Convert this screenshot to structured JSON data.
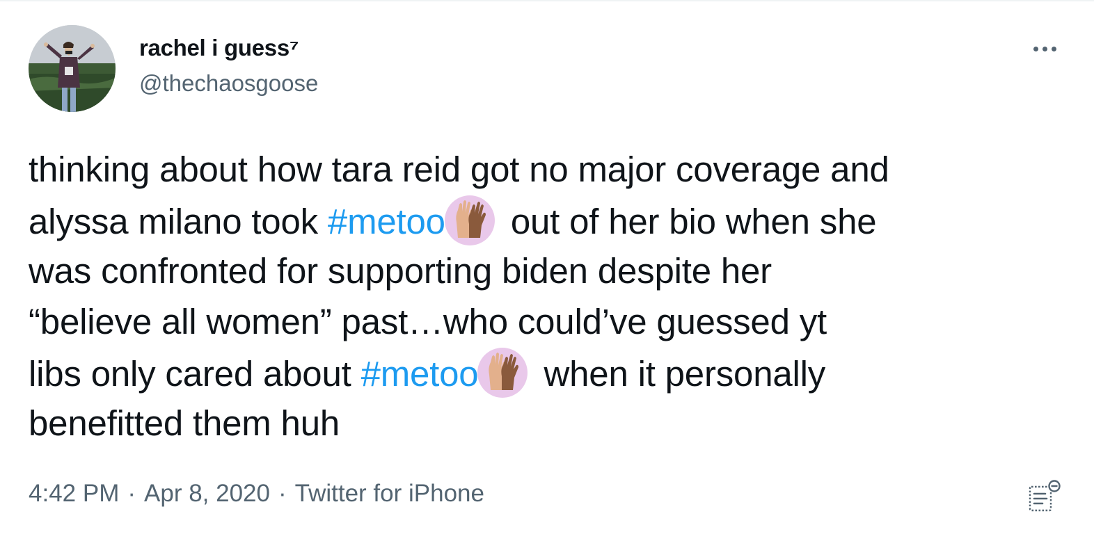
{
  "user": {
    "display_name": "rachel i guess⁷",
    "handle": "@thechaosgoose",
    "avatar_icon": "profile-photo"
  },
  "header": {
    "more_icon": "more-horizontal-icon"
  },
  "tweet": {
    "lines": [
      [
        {
          "t": "text",
          "v": "thinking about how tara reid got no major coverage and"
        }
      ],
      [
        {
          "t": "text",
          "v": "alyssa milano took "
        },
        {
          "t": "hashtag",
          "v": "#metoo"
        },
        {
          "t": "hashflag",
          "v": "raised-hands-hashflag"
        },
        {
          "t": "text",
          "v": "out of her bio when she"
        }
      ],
      [
        {
          "t": "text",
          "v": "was confronted for supporting biden despite her"
        }
      ],
      [
        {
          "t": "text",
          "v": "“believe all women” past…who could’ve guessed yt"
        }
      ],
      [
        {
          "t": "text",
          "v": "libs only cared about "
        },
        {
          "t": "hashtag",
          "v": "#metoo"
        },
        {
          "t": "hashflag",
          "v": "raised-hands-hashflag"
        },
        {
          "t": "text",
          "v": "when it personally"
        }
      ],
      [
        {
          "t": "text",
          "v": "benefitted them huh"
        }
      ]
    ],
    "hashtag_color": "#1d9bf0",
    "text_color": "#0f1419"
  },
  "meta": {
    "time": "4:42 PM",
    "separator": "·",
    "date": "Apr 8, 2020",
    "source": "Twitter for iPhone",
    "color": "#536471"
  },
  "footer": {
    "analytics_icon": "view-analytics-icon"
  }
}
